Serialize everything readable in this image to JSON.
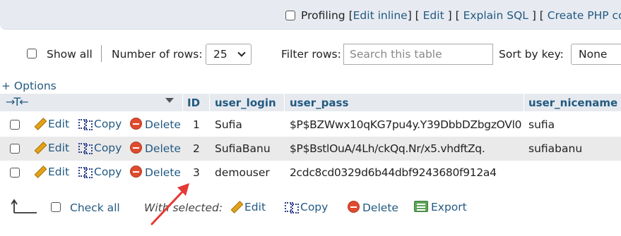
{
  "sqlbar": {
    "profiling_label": "Profiling",
    "edit_inline": "Edit inline",
    "edit": "Edit",
    "explain_sql": "Explain SQL",
    "create_php_code": "Create PHP code"
  },
  "controls": {
    "show_all_label": "Show all",
    "number_of_rows_label": "Number of rows:",
    "number_of_rows_value": "25",
    "filter_rows_label": "Filter rows:",
    "search_placeholder": "Search this table",
    "sort_by_key_label": "Sort by key:",
    "sort_by_key_value": "None"
  },
  "options_link": "+ Options",
  "table": {
    "columns": [
      "ID",
      "user_login",
      "user_pass",
      "user_nicename"
    ],
    "row_actions": {
      "edit": "Edit",
      "copy": "Copy",
      "delete": "Delete"
    },
    "rows": [
      {
        "id": "1",
        "user_login": "Sufia",
        "user_pass": "$P$BZWwx10qKG7pu4y.Y39DbbDZbgzOVl0",
        "user_nicename": "sufia"
      },
      {
        "id": "2",
        "user_login": "SufiaBanu",
        "user_pass": "$P$BstlOuA/4Lh/ckQq.Nr/x5.vhdftZq.",
        "user_nicename": "sufiabanu"
      },
      {
        "id": "3",
        "user_login": "demouser",
        "user_pass": "2cdc8cd0329d6b44dbf9243680f912a4",
        "user_nicename": ""
      }
    ]
  },
  "bottom": {
    "check_all": "Check all",
    "with_selected": "With selected:",
    "edit": "Edit",
    "copy": "Copy",
    "delete": "Delete",
    "export": "Export"
  },
  "colors": {
    "link": "#235a81",
    "header_bg": "#e6eaef",
    "alt_row_bg": "#eaeaea",
    "annotation_arrow": "#e53935"
  }
}
